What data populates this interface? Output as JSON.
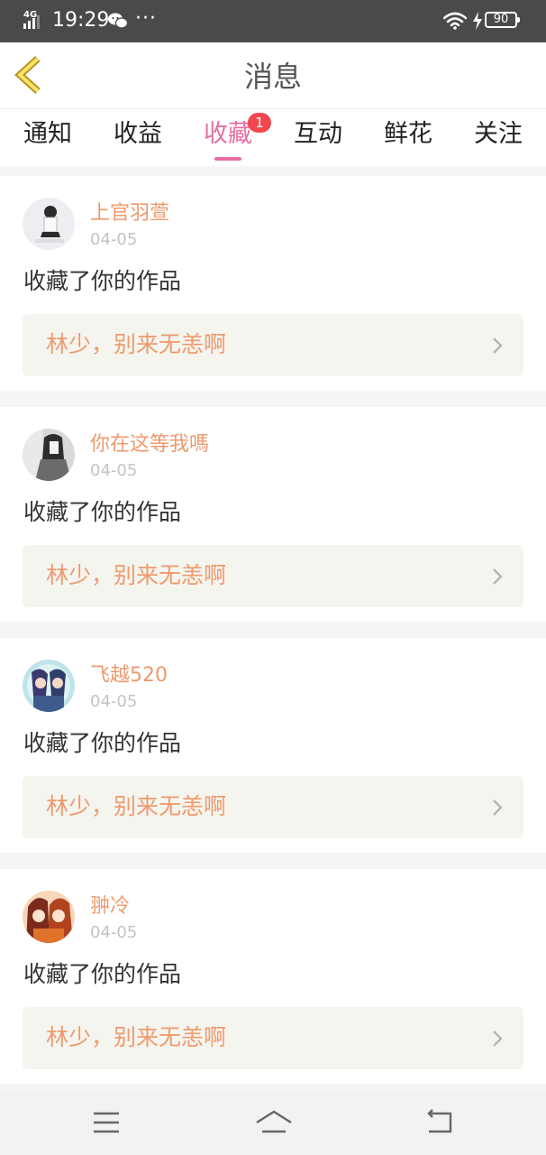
{
  "status_bar": {
    "network": "4G",
    "time": "19:29",
    "more": "···",
    "battery": "90",
    "icons": [
      "signal-icon",
      "wechat-icon",
      "wifi-icon",
      "charging-icon",
      "battery-icon"
    ]
  },
  "header": {
    "title": "消息",
    "back_icon": "chevron-left-icon"
  },
  "tabs": [
    {
      "label": "通知"
    },
    {
      "label": "收益"
    },
    {
      "label": "收藏",
      "active": true,
      "badge": "1"
    },
    {
      "label": "互动"
    },
    {
      "label": "鲜花"
    },
    {
      "label": "关注"
    }
  ],
  "notifications": [
    {
      "username": "上官羽萱",
      "date": "04-05",
      "action": "收藏了你的作品",
      "work_title": "林少，别来无恙啊"
    },
    {
      "username": "你在这等我嗎",
      "date": "04-05",
      "action": "收藏了你的作品",
      "work_title": "林少，别来无恙啊"
    },
    {
      "username": "飞越520",
      "date": "04-05",
      "action": "收藏了你的作品",
      "work_title": "林少，别来无恙啊"
    },
    {
      "username": "翀冷",
      "date": "04-05",
      "action": "收藏了你的作品",
      "work_title": "林少，别来无恙啊"
    }
  ],
  "nav_bar": {
    "icons": [
      "menu-icon",
      "home-icon",
      "back-icon"
    ]
  },
  "colors": {
    "accent": "#e76ea3",
    "username": "#ee9a6e",
    "badge": "#f2474f",
    "work_bg": "#f5f5ef",
    "status_bar": "#4a4a4a"
  }
}
